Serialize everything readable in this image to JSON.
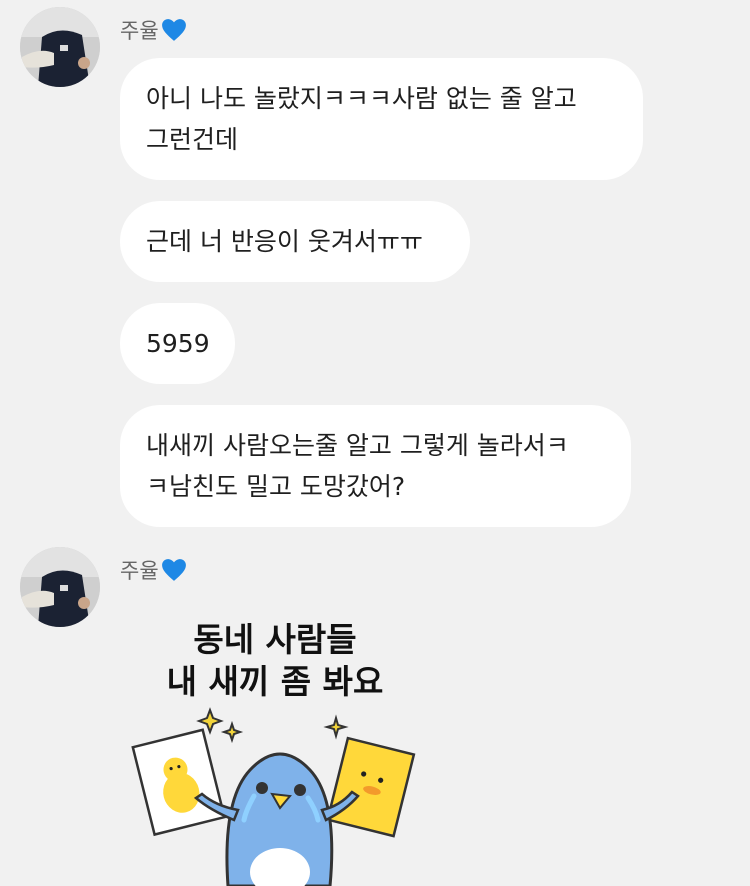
{
  "messages": [
    {
      "sender": "주율",
      "lines": [
        "아니 나도 놀랐지ㅋㅋㅋ사람 없는 줄 알고",
        "그런건데"
      ]
    },
    {
      "lines": [
        "근데 너 반응이 웃겨서ㅠㅠ"
      ]
    },
    {
      "lines": [
        "5959"
      ]
    },
    {
      "lines": [
        "내새끼 사람오는줄 알고 그렇게 놀라서ㅋ",
        "ㅋ남친도 밀고 도망갔어?"
      ]
    }
  ],
  "second_group": {
    "sender": "주율",
    "sticker": {
      "line1": "동네 사람들",
      "line2": "내 새끼 좀 봐요"
    }
  },
  "colors": {
    "background": "#f1f1f1",
    "bubble": "#ffffff",
    "heart": "#1e88e5",
    "penguin": "#7fb2ea",
    "chick": "#ffd83a"
  },
  "icons": {
    "heart": "blue-heart-icon",
    "avatar": "profile-photo"
  }
}
